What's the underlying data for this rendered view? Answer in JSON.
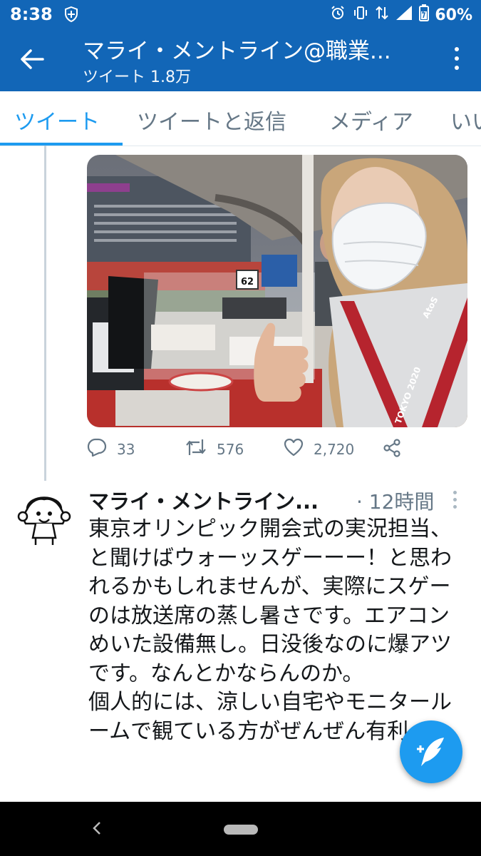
{
  "status_bar": {
    "time": "8:38",
    "battery": "60%",
    "icons": [
      "shield-icon",
      "alarm-icon",
      "vibrate-icon",
      "data-arrows-icon",
      "signal-icon",
      "battery-icon"
    ]
  },
  "app_bar": {
    "title": "マライ・メントライン@職業...",
    "subtitle": "ツイート 1.8万",
    "back_icon": "arrow-left-icon",
    "menu_icon": "more-vertical-icon"
  },
  "tabs": [
    {
      "label": "ツイート",
      "active": true
    },
    {
      "label": "ツイートと返信",
      "active": false
    },
    {
      "label": "メディア",
      "active": false
    },
    {
      "label": "いい",
      "active": false
    }
  ],
  "media_tweet": {
    "photo_signs": {
      "desk_number": "62",
      "lanyard_brand": "AtoS",
      "lanyard_event": "TOKYO 2020"
    },
    "actions": {
      "replies": "33",
      "retweets": "576",
      "likes": "2,720"
    }
  },
  "tweet": {
    "author": "マライ・メントライン...",
    "time": "· 12時間",
    "text": "東京オリンピック開会式の実況担当、と聞けばウォーッスゲーーー！と思われるかもしれませんが、実際にスゲーのは放送席の蒸し暑さです。エアコンめいた設備無し。日没後なのに爆アツです。なんとかならんのか。\n個人的には、涼しい自宅やモニタールームで観ている方がぜんぜん有利。"
  },
  "colors": {
    "accent": "#1d9bf0",
    "app_bar": "#1266b7",
    "muted": "#657786",
    "nav_bar": "#000000"
  }
}
